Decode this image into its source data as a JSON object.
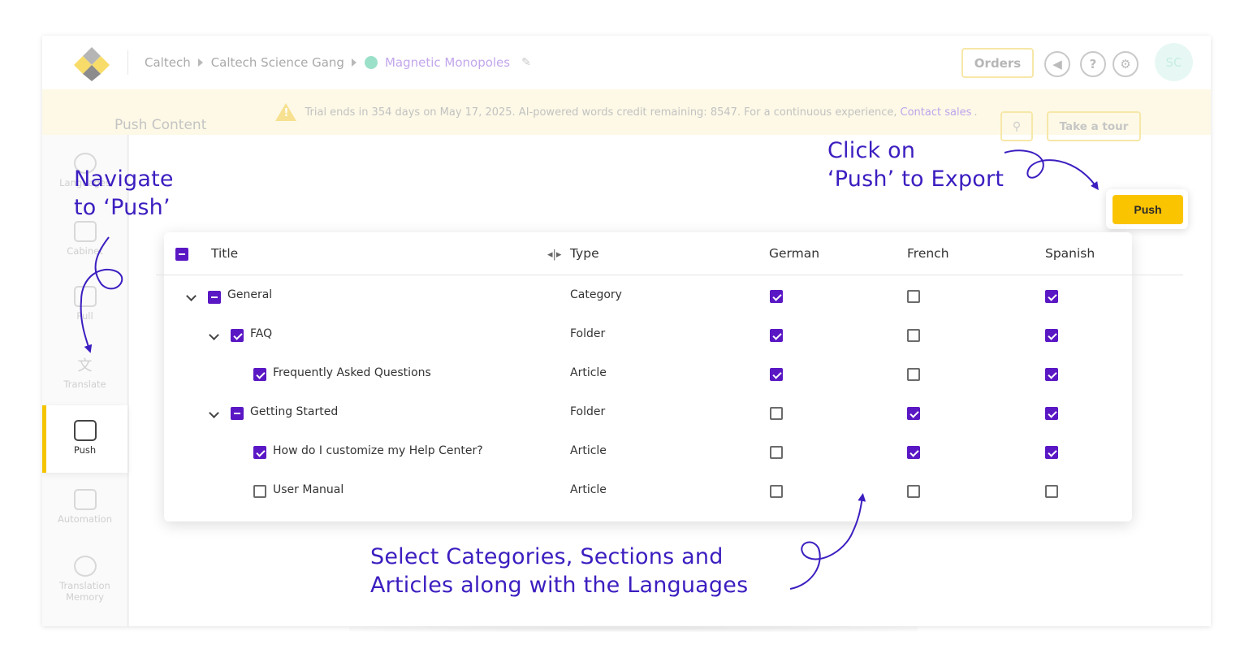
{
  "breadcrumb": [
    "Caltech",
    "Caltech Science Gang",
    "Magnetic Monopoles"
  ],
  "topbar": {
    "orders_label": "Orders",
    "avatar_initials": "SC",
    "icons": [
      "megaphone-icon",
      "help-icon",
      "gear-icon"
    ]
  },
  "banner": {
    "text": "Trial ends in 354 days on May 17, 2025. AI-powered words credit remaining: 8547. For a continuous experience,",
    "link": "Contact sales",
    "trail": "."
  },
  "sidebar": {
    "items": [
      {
        "label": "Languages",
        "icon": "languages-icon"
      },
      {
        "label": "Cabinet",
        "icon": "cabinet-icon"
      },
      {
        "label": "Pull",
        "icon": "pull-icon"
      },
      {
        "label": "Translate",
        "icon": "translate-icon"
      },
      {
        "label": "Push",
        "icon": "push-icon",
        "active": true
      },
      {
        "label": "Automation",
        "icon": "automation-icon"
      },
      {
        "label": "Translation",
        "label2": "Memory",
        "icon": "brain-icon"
      }
    ]
  },
  "content": {
    "title": "Push Content",
    "tour_label": "Take a tour",
    "push_label": "Push"
  },
  "table": {
    "headers": {
      "title": "Title",
      "type": "Type",
      "langs": [
        "German",
        "French",
        "Spanish"
      ]
    },
    "rows": [
      {
        "title": "General",
        "type": "Category",
        "langs": [
          true,
          false,
          true
        ]
      },
      {
        "title": "FAQ",
        "type": "Folder",
        "langs": [
          true,
          false,
          true
        ]
      },
      {
        "title": "Frequently Asked Questions",
        "type": "Article",
        "langs": [
          true,
          false,
          true
        ]
      },
      {
        "title": "Getting Started",
        "type": "Folder",
        "langs": [
          false,
          true,
          true
        ]
      },
      {
        "title": "How do I customize my Help Center?",
        "type": "Article",
        "langs": [
          false,
          true,
          true
        ]
      },
      {
        "title": "User Manual",
        "type": "Article",
        "langs": [
          false,
          false,
          false
        ]
      }
    ]
  },
  "annotations": {
    "nav1": "Navigate",
    "nav2": "to ‘Push’",
    "click1": "Click on",
    "click2": "‘Push’ to Export",
    "select1": "Select Categories, Sections and",
    "select2": "Articles along with the Languages"
  },
  "colors": {
    "accent": "#5a17c4",
    "brand_yellow": "#fbc400",
    "annotation": "#3c1ec0"
  }
}
